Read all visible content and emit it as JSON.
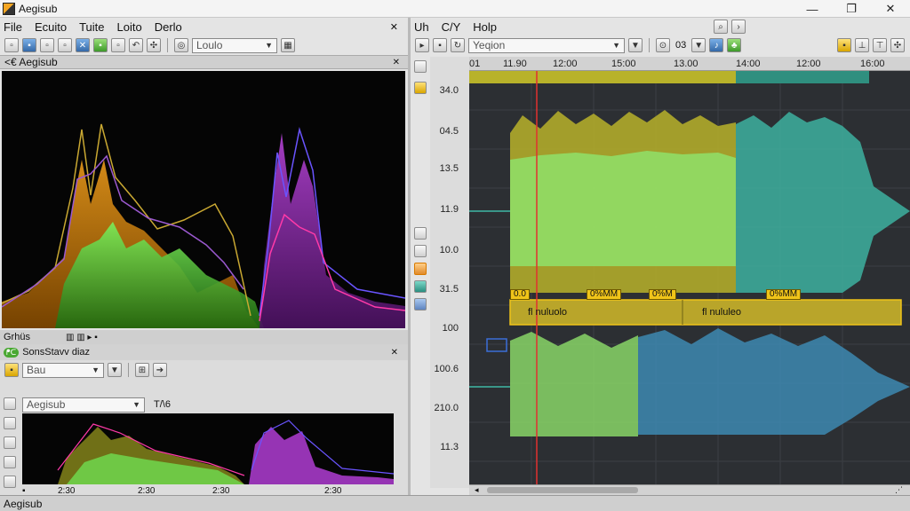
{
  "window": {
    "title": "Aegisub",
    "minimize": "—",
    "maximize": "❐",
    "close": "✕"
  },
  "left_menu": {
    "items": [
      "File",
      "Ecuito",
      "Tuite",
      "Loito",
      "Derlo"
    ],
    "close": "✕"
  },
  "left_toolbar": {
    "combo_value": "Loulo"
  },
  "spectrum_panel": {
    "title": "<€ Aegisub",
    "close": "✕"
  },
  "sub_panel": {
    "title": "Grhüs",
    "header2": "SonsStavv diaz",
    "combo1": "Bau",
    "combo2": "Aegisub",
    "label_tab": "T/\\6",
    "times": [
      "2:30",
      "2:30",
      "2:30",
      "2:30"
    ]
  },
  "right_menu": {
    "items": [
      "Uh",
      "C/Y",
      "Holp"
    ]
  },
  "right_toolbar": {
    "combo_value": "Yeqion",
    "zoom_label": "03"
  },
  "audio": {
    "timeline": [
      "01",
      "11.90",
      "12:00",
      "15:00",
      "13.00",
      "14:00",
      "12:00",
      "16:00"
    ],
    "yaxis": [
      "34.0",
      "04.5",
      "13.5",
      "11.9",
      "10.0",
      "31.5",
      "100",
      "100.6",
      "210.0",
      "11.3"
    ],
    "tags": [
      "0.0",
      "0%MM",
      "0%M",
      "0%MM"
    ],
    "subtitle_lines": [
      "fl nuluolo",
      "fl nululeo"
    ]
  },
  "statusbar": {
    "text": "Aegisub"
  },
  "colors": {
    "yellow_wave": "#c9c33a",
    "green_wave": "#8fe06a",
    "teal_wave": "#3fb9a6",
    "cursor": "#e23030"
  }
}
